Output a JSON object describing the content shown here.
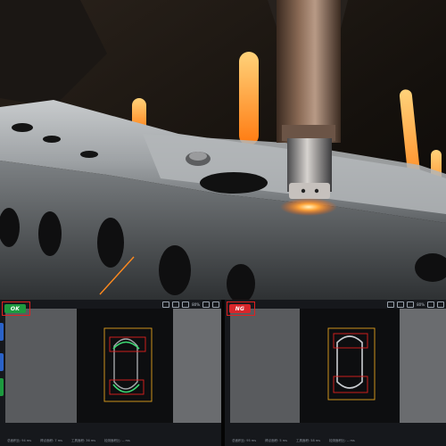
{
  "left_panel": {
    "status": "OK",
    "status_color": "#1d9a3f",
    "zoom": "80%",
    "footer": [
      "总面积比: 94 ms",
      "焊点面积: 7 ms",
      "工具面积: 36 ms",
      "检测面积比: -- ms"
    ]
  },
  "right_panel": {
    "status": "NG",
    "status_color": "#d9262b",
    "zoom": "80%",
    "footer": [
      "总面积比: 95 ms",
      "焊点面积: 5 ms",
      "工具面积: 58 ms",
      "检测面积比: -- ms"
    ]
  },
  "colors": {
    "roi_box": "#e0a020",
    "detect_box": "#e02020",
    "weld_ok": "#3ddc74",
    "spark": "#ff8a1e"
  }
}
